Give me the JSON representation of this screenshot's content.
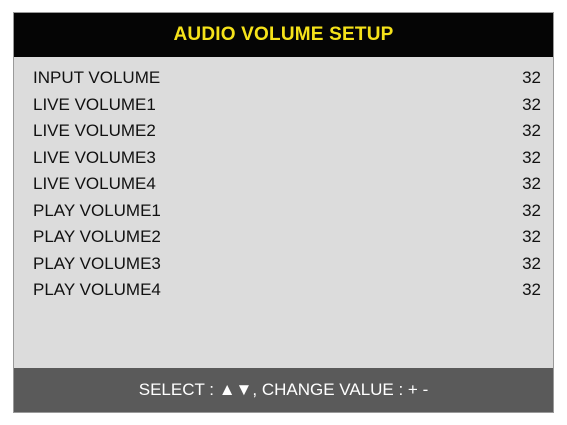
{
  "header": {
    "title": "AUDIO VOLUME SETUP"
  },
  "rows": [
    {
      "label": "INPUT VOLUME",
      "value": "32"
    },
    {
      "label": "LIVE VOLUME1",
      "value": "32"
    },
    {
      "label": "LIVE VOLUME2",
      "value": "32"
    },
    {
      "label": "LIVE VOLUME3",
      "value": "32"
    },
    {
      "label": "LIVE VOLUME4",
      "value": "32"
    },
    {
      "label": "PLAY VOLUME1",
      "value": "32"
    },
    {
      "label": "PLAY VOLUME2",
      "value": "32"
    },
    {
      "label": "PLAY VOLUME3",
      "value": "32"
    },
    {
      "label": "PLAY VOLUME4",
      "value": "32"
    }
  ],
  "footer": {
    "hint": "SELECT : ▲▼, CHANGE VALUE : + -"
  },
  "colors": {
    "header_bg": "#050505",
    "title_text": "#f5e21a",
    "panel_bg": "#dcdcdc",
    "footer_bg": "#5a5a5a",
    "footer_text": "#ffffff"
  }
}
